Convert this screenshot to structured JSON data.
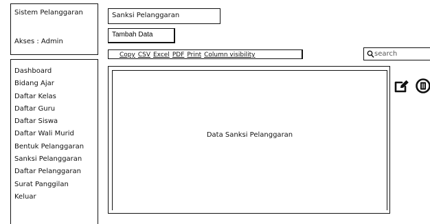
{
  "sidebar": {
    "app_title": "Sistem Pelanggaran",
    "access": "Akses : Admin",
    "menu": [
      "Dashboard",
      "Bidang Ajar",
      "Daftar Kelas",
      "Daftar Guru",
      "Daftar Siswa",
      "Daftar Wali Murid",
      "Bentuk Pelanggaran",
      "Sanksi Pelanggaran",
      "Daftar Pelanggaran",
      "Surat Panggilan",
      "Keluar"
    ]
  },
  "header": {
    "page_title": "Sanksi Pelanggaran",
    "add_button": "Tambah Data"
  },
  "toolbar": {
    "buttons": [
      "Copy",
      "CSV",
      "Excel",
      "PDF",
      "Print",
      "Column visibility"
    ]
  },
  "search": {
    "placeholder": "search",
    "icon": "magnifier-icon"
  },
  "content": {
    "placeholder_text": "Data Sanksi Pelanggaran"
  },
  "actions": {
    "edit_icon": "edit-icon",
    "delete_icon": "delete-icon"
  }
}
